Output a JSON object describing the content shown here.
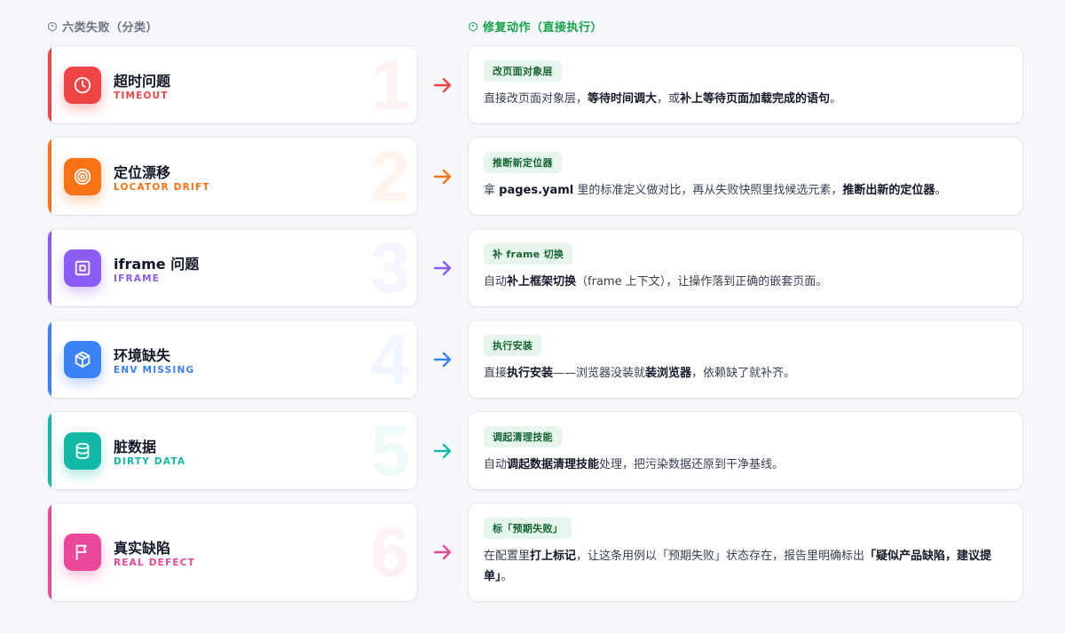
{
  "left_header": "六类失败（分类）",
  "right_header": "修复动作（直接执行）",
  "rows": [
    {
      "num": "1",
      "title": "超时问题",
      "subtitle": "TIMEOUT",
      "color": "#ef4444",
      "icon": "clock-icon",
      "tag": "改页面对象层",
      "desc": [
        {
          "t": "直接改页面对象层，",
          "b": false
        },
        {
          "t": "等待时间调大",
          "b": true
        },
        {
          "t": "，或",
          "b": false
        },
        {
          "t": "补上等待页面加载完成的语句",
          "b": true
        },
        {
          "t": "。",
          "b": false
        }
      ]
    },
    {
      "num": "2",
      "title": "定位漂移",
      "subtitle": "LOCATOR DRIFT",
      "color": "#f97316",
      "icon": "target-icon",
      "tag": "推断新定位器",
      "desc": [
        {
          "t": "拿 ",
          "b": false
        },
        {
          "t": "pages.yaml",
          "b": true
        },
        {
          "t": " 里的标准定义做对比，再从失败快照里找候选元素，",
          "b": false
        },
        {
          "t": "推断出新的定位器",
          "b": true
        },
        {
          "t": "。",
          "b": false
        }
      ]
    },
    {
      "num": "3",
      "title": "iframe 问题",
      "subtitle": "IFRAME",
      "color": "#8b5cf6",
      "icon": "frame-icon",
      "tag": "补 frame 切换",
      "desc": [
        {
          "t": "自动",
          "b": false
        },
        {
          "t": "补上框架切换",
          "b": true
        },
        {
          "t": "（frame 上下文），让操作落到正确的嵌套页面。",
          "b": false
        }
      ]
    },
    {
      "num": "4",
      "title": "环境缺失",
      "subtitle": "ENV MISSING",
      "color": "#3b82f6",
      "icon": "package-icon",
      "tag": "执行安装",
      "desc": [
        {
          "t": "直接",
          "b": false
        },
        {
          "t": "执行安装",
          "b": true
        },
        {
          "t": "——浏览器没装就",
          "b": false
        },
        {
          "t": "装浏览器",
          "b": true
        },
        {
          "t": "，依赖缺了就补齐。",
          "b": false
        }
      ]
    },
    {
      "num": "5",
      "title": "脏数据",
      "subtitle": "DIRTY DATA",
      "color": "#14b8a6",
      "icon": "database-icon",
      "tag": "调起清理技能",
      "desc": [
        {
          "t": "自动",
          "b": false
        },
        {
          "t": "调起数据清理技能",
          "b": true
        },
        {
          "t": "处理，把污染数据还原到干净基线。",
          "b": false
        }
      ]
    },
    {
      "num": "6",
      "title": "真实缺陷",
      "subtitle": "REAL DEFECT",
      "color": "#ec4899",
      "icon": "flag-icon",
      "tag": "标「预期失败」",
      "desc": [
        {
          "t": "在配置里",
          "b": false
        },
        {
          "t": "打上标记",
          "b": true
        },
        {
          "t": "，让这条用例以「预期失败」状态存在，报告里明确标出",
          "b": false
        },
        {
          "t": "「疑似产品缺陷，建议提单」",
          "b": true
        },
        {
          "t": "。",
          "b": false
        }
      ]
    }
  ]
}
